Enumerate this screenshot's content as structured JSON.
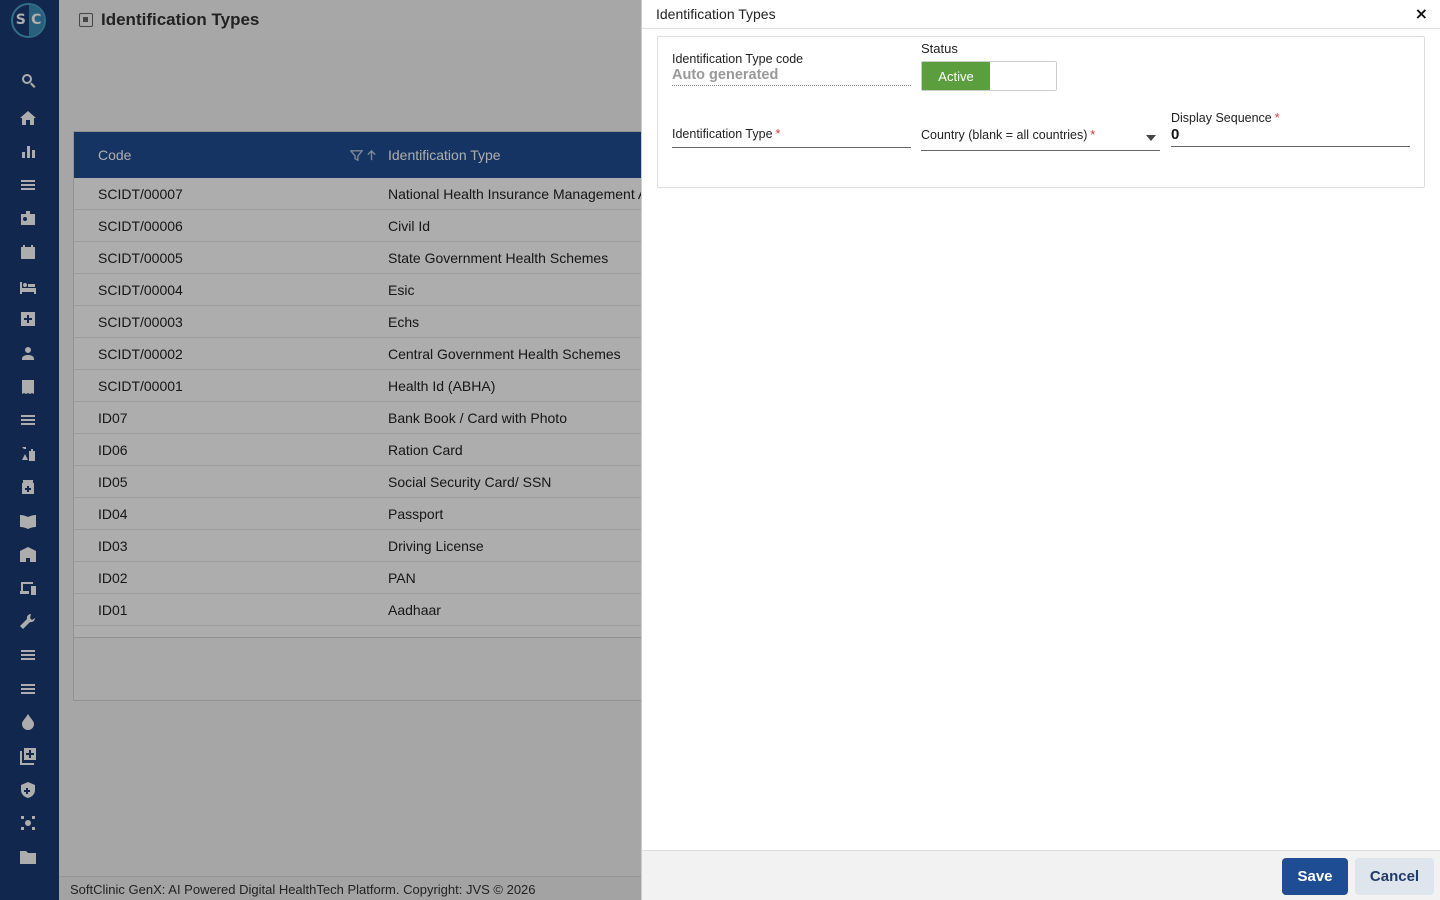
{
  "app": {
    "logo_left": "S",
    "logo_right": "C",
    "page_title": "Identification Types",
    "footer_text": "SoftClinic GenX: AI Powered Digital HealthTech Platform. Copyright: JVS © 2026"
  },
  "sidebar": {
    "icons": [
      "search-icon",
      "home-icon",
      "bar-chart-icon",
      "menu-icon",
      "badge-icon",
      "calendar-icon",
      "bed-icon",
      "plus-box-icon",
      "person-icon",
      "receipt-icon",
      "list-icon",
      "lab-icon",
      "pharmacy-icon",
      "book-icon",
      "building-icon",
      "devices-icon",
      "wrench-icon",
      "list-icon-2",
      "list-icon-3",
      "drop-icon",
      "library-add-icon",
      "shield-icon",
      "hub-icon",
      "folder-icon"
    ]
  },
  "grid": {
    "columns": {
      "code": "Code",
      "type": "Identification Type"
    },
    "rows": [
      {
        "code": "SCIDT/00007",
        "type": "National Health Insurance Management A"
      },
      {
        "code": "SCIDT/00006",
        "type": "Civil Id"
      },
      {
        "code": "SCIDT/00005",
        "type": "State Government Health Schemes"
      },
      {
        "code": "SCIDT/00004",
        "type": "Esic"
      },
      {
        "code": "SCIDT/00003",
        "type": "Echs"
      },
      {
        "code": "SCIDT/00002",
        "type": "Central Government Health Schemes"
      },
      {
        "code": "SCIDT/00001",
        "type": "Health Id (ABHA)"
      },
      {
        "code": "ID07",
        "type": "Bank Book / Card with Photo"
      },
      {
        "code": "ID06",
        "type": "Ration Card"
      },
      {
        "code": "ID05",
        "type": "Social Security Card/ SSN"
      },
      {
        "code": "ID04",
        "type": "Passport"
      },
      {
        "code": "ID03",
        "type": "Driving License"
      },
      {
        "code": "ID02",
        "type": "PAN"
      },
      {
        "code": "ID01",
        "type": "Aadhaar"
      }
    ]
  },
  "drawer": {
    "title": "Identification Types",
    "close_label": "×",
    "code_label": "Identification Type code",
    "code_value": "Auto generated",
    "status_label": "Status",
    "status_active": "Active",
    "id_type_label": "Identification Type",
    "country_label": "Country (blank = all countries)",
    "display_seq_label": "Display Sequence",
    "display_seq_value": "0",
    "required_mark": "*",
    "save_label": "Save",
    "cancel_label": "Cancel"
  }
}
